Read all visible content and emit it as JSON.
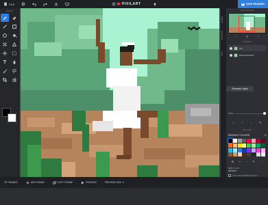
{
  "topbar": {
    "file_label": "FILE",
    "logo_text": "PIXILART",
    "save_label": "SAVE DRAWING"
  },
  "tools": {
    "title": "TOOLS",
    "items": [
      {
        "icon": "pencil-icon"
      },
      {
        "icon": "eraser-icon"
      },
      {
        "icon": "line-icon"
      },
      {
        "icon": "rectangle-icon"
      },
      {
        "icon": "circle-icon"
      },
      {
        "icon": "paint-bucket-icon"
      },
      {
        "icon": "dither-icon"
      },
      {
        "icon": "move-icon"
      },
      {
        "icon": "text-icon"
      },
      {
        "icon": "lighten-icon"
      },
      {
        "icon": "eyedropper-icon"
      },
      {
        "icon": "lasso-icon"
      },
      {
        "icon": "select-icon"
      }
    ],
    "primary_color": "#000000",
    "secondary_color": "#ffffff"
  },
  "side_tabs": [
    "LAYERS",
    "SETTINGS",
    "TOOL"
  ],
  "panel": {
    "navigation_title": "NAVIGATION",
    "layers_title": "LAYERS",
    "layers": [
      {
        "name": "Girl",
        "selected": true
      },
      {
        "name": "BACKGROUND",
        "selected": false
      }
    ],
    "opacity_label": "100%",
    "tooltip": "Rename Layer",
    "colors_title": "COLORS",
    "palette_name": "DEFAULT COLORS",
    "palette": [
      "#000000",
      "#ffffff",
      "#9e9e9e",
      "#5c5c5c",
      "#ff0040",
      "#ff9bb0",
      "#b0003a",
      "#6d001b",
      "#ff6a00",
      "#ffb880",
      "#ffe600",
      "#fff6a0",
      "#3bd15a",
      "#a7ef9b",
      "#00a86b",
      "#0b5d3a",
      "#00c8ff",
      "#9ee8ff",
      "#2f7fe0",
      "#1b3f9c",
      "#7b2fff",
      "#c8a8ff",
      "#ff3bd5",
      "#ffb0ef",
      "#8a5a3b",
      "#c89a6a",
      "#f2d3b1",
      "#4a2c1a",
      "#404040",
      "#2a2a2a",
      "#d9d9d9",
      "#ececec"
    ],
    "color_info_line1": "C(0): 0, 0, 0",
    "color_info_line2": "#000000",
    "lock_label": "LOCK TRANSPARENT PIXELS"
  },
  "bottombar": {
    "items": [
      {
        "label": "ADD FRAME"
      },
      {
        "label": "COPY FRAME"
      },
      {
        "label": "PREVIEW"
      },
      {
        "label": "PREVIEW SIZE"
      }
    ],
    "left_label": "OF FRAMES"
  }
}
